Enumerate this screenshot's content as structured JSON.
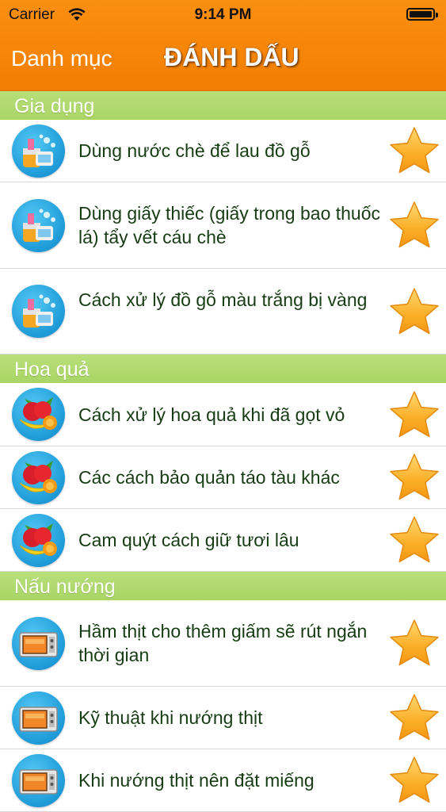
{
  "status_bar": {
    "carrier": "Carrier",
    "time": "9:14 PM"
  },
  "nav": {
    "back_label": "Danh mục",
    "title": "ĐÁNH DẤU"
  },
  "colors": {
    "nav": "#f58607",
    "section": "#acd66b",
    "title_text": "#173c14",
    "star": "#fbb12b"
  },
  "sections": [
    {
      "header": "Gia dụng",
      "icon": "cleaning-supplies-icon",
      "items": [
        {
          "title": "Dùng nước chè để lau đồ gỗ"
        },
        {
          "title": "Dùng giấy thiếc (giấy trong bao thuốc lá) tẩy vết cáu chè"
        },
        {
          "title": "Cách xử lý đồ gỗ màu trắng bị vàng"
        }
      ]
    },
    {
      "header": "Hoa quả",
      "icon": "fruit-bowl-icon",
      "items": [
        {
          "title": "Cách xử lý hoa quả khi đã gọt vỏ"
        },
        {
          "title": "Các cách bảo quản táo tàu khác"
        },
        {
          "title": "Cam quýt cách giữ tươi lâu"
        }
      ]
    },
    {
      "header": "Nấu nướng",
      "icon": "oven-icon",
      "items": [
        {
          "title": "Hầm thịt cho thêm giấm sẽ rút ngắn thời gian"
        },
        {
          "title": "Kỹ thuật khi nướng thịt"
        },
        {
          "title": "Khi nướng thịt nên đặt miếng"
        }
      ]
    }
  ]
}
